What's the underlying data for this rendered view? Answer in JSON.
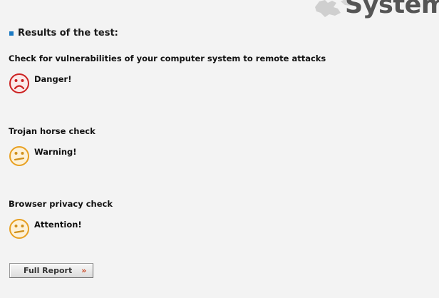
{
  "brand": {
    "text": "System"
  },
  "results": {
    "title": "Results of the test:",
    "checks": [
      {
        "label": "Check for vulnerabilities of your computer system to remote attacks",
        "status": "Danger!",
        "icon": "sad-face-icon",
        "color": "#cc2222"
      },
      {
        "label": "Trojan horse check",
        "status": "Warning!",
        "icon": "neutral-face-icon",
        "color": "#e8a020"
      },
      {
        "label": "Browser privacy check",
        "status": "Attention!",
        "icon": "neutral-face-icon",
        "color": "#e8a020"
      }
    ]
  },
  "actions": {
    "full_report_label": "Full Report",
    "full_report_arrow": "»"
  },
  "colors": {
    "bullet": "#1b7ac3",
    "danger": "#cc2222",
    "warning": "#e8a020"
  }
}
